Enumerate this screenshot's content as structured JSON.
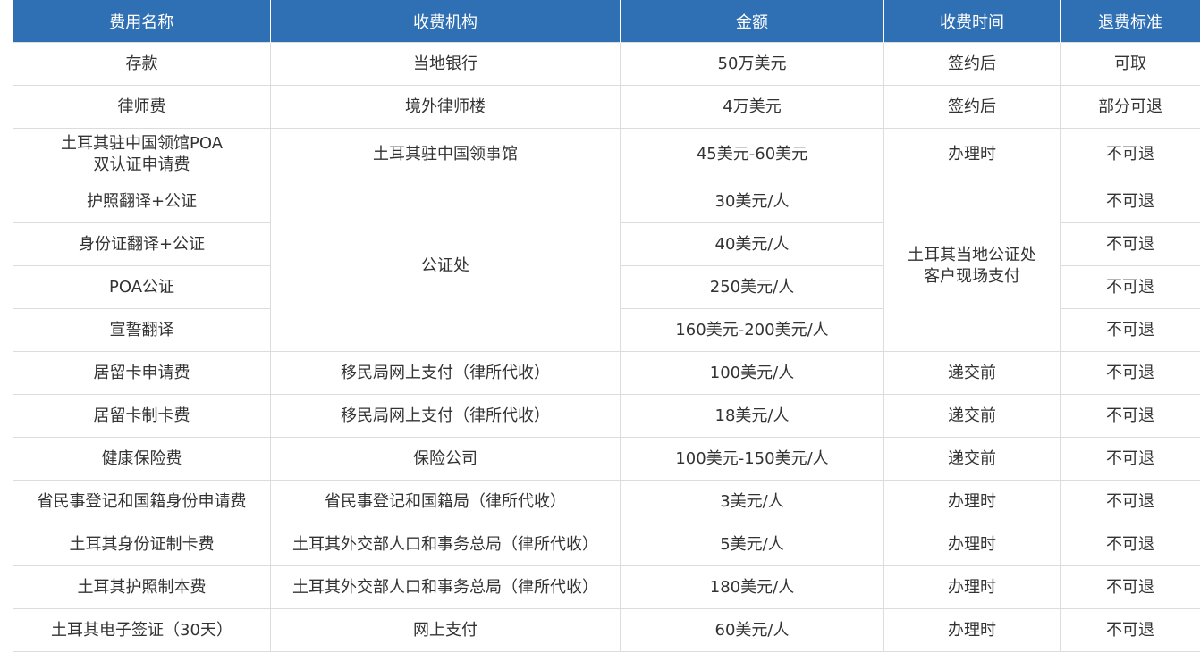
{
  "headers": [
    "费用名称",
    "收费机构",
    "金额",
    "收费时间",
    "退费标准"
  ],
  "rows": [
    {
      "name": "存款",
      "org": "当地银行",
      "amount": "50万美元",
      "time": "签约后",
      "refund": "可取"
    },
    {
      "name": "律师费",
      "org": "境外律师楼",
      "amount": "4万美元",
      "time": "签约后",
      "refund": "部分可退"
    },
    {
      "name_line1": "土耳其驻中国领馆POA",
      "name_line2": "双认证申请费",
      "org": "土耳其驻中国领事馆",
      "amount": "45美元-60美元",
      "time": "办理时",
      "refund": "不可退"
    },
    {
      "name": "护照翻译+公证",
      "amount": "30美元/人",
      "refund": "不可退"
    },
    {
      "name": "身份证翻译+公证",
      "amount": "40美元/人",
      "refund": "不可退"
    },
    {
      "name": "POA公证",
      "amount": "250美元/人",
      "refund": "不可退"
    },
    {
      "name": "宣誓翻译",
      "amount": "160美元-200美元/人",
      "refund": "不可退"
    },
    {
      "name": "居留卡申请费",
      "org": "移民局网上支付（律所代收）",
      "amount": "100美元/人",
      "time": "递交前",
      "refund": "不可退"
    },
    {
      "name": "居留卡制卡费",
      "org": "移民局网上支付（律所代收）",
      "amount": "18美元/人",
      "time": "递交前",
      "refund": "不可退"
    },
    {
      "name": "健康保险费",
      "org": "保险公司",
      "amount": "100美元-150美元/人",
      "time": "递交前",
      "refund": "不可退"
    },
    {
      "name": "省民事登记和国籍身份申请费",
      "org": "省民事登记和国籍局（律所代收）",
      "amount": "3美元/人",
      "time": "办理时",
      "refund": "不可退"
    },
    {
      "name": "土耳其身份证制卡费",
      "org": "土耳其外交部人口和事务总局（律所代收）",
      "amount": "5美元/人",
      "time": "办理时",
      "refund": "不可退"
    },
    {
      "name": "土耳其护照制本费",
      "org": "土耳其外交部人口和事务总局（律所代收）",
      "amount": "180美元/人",
      "time": "办理时",
      "refund": "不可退"
    },
    {
      "name": "土耳其电子签证（30天）",
      "org": "网上支付",
      "amount": "60美元/人",
      "time": "办理时",
      "refund": "不可退"
    }
  ],
  "merged": {
    "notary_org": "公证处",
    "notary_time_line1": "土耳其当地公证处",
    "notary_time_line2": "客户现场支付"
  }
}
